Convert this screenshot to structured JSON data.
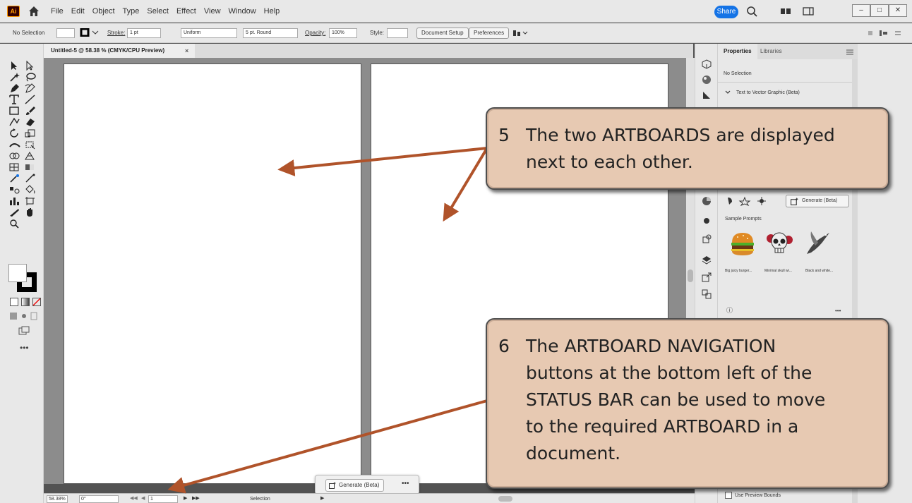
{
  "menubar": {
    "logo": "Ai",
    "items": [
      "File",
      "Edit",
      "Object",
      "Type",
      "Select",
      "Effect",
      "View",
      "Window",
      "Help"
    ],
    "share_label": "Share",
    "window_buttons": [
      "–",
      "□",
      "✕"
    ]
  },
  "controlbar": {
    "selection": "No Selection",
    "stroke_label": "Stroke:",
    "stroke_value": "1 pt",
    "profile": "Uniform",
    "brush": "5 pt. Round",
    "opacity_label": "Opacity:",
    "opacity_value": "100%",
    "style_label": "Style:",
    "doc_setup": "Document Setup",
    "preferences": "Preferences"
  },
  "document": {
    "tab_title": "Untitled-5 @ 58.38 % (CMYK/CPU Preview)",
    "close": "×"
  },
  "status": {
    "zoom": "58.38%",
    "rotation": "0°",
    "artboard_number": "1",
    "tool": "Selection"
  },
  "contextual": {
    "generate_label": "Generate (Beta)",
    "more": "•••"
  },
  "toolbar": {
    "more": "•••"
  },
  "properties": {
    "tabs": [
      "Properties",
      "Libraries"
    ],
    "no_selection": "No Selection",
    "section": "Text to Vector Graphic (Beta)",
    "generate_label": "Generate (Beta)",
    "sample_prompts": "Sample Prompts",
    "prompts": [
      "Big juicy burger...",
      "Minimal skull wi...",
      "Black and white..."
    ],
    "info": "ⓘ",
    "more": "•••",
    "use_preview_bounds": "Use Preview Bounds"
  },
  "callouts": [
    {
      "number": "5",
      "lines": [
        "The two ARTBOARDS are displayed",
        "next to each other."
      ]
    },
    {
      "number": "6",
      "lines": [
        "The ARTBOARD NAVIGATION",
        "buttons at the bottom left of the",
        "STATUS BAR can be used to move",
        "to the required ARTBOARD in a",
        "document."
      ]
    }
  ],
  "colors": {
    "callout_fill": "#e7c9b2",
    "arrow": "#b0532a",
    "share": "#1473e6",
    "canvas": "#8c8c8c"
  }
}
